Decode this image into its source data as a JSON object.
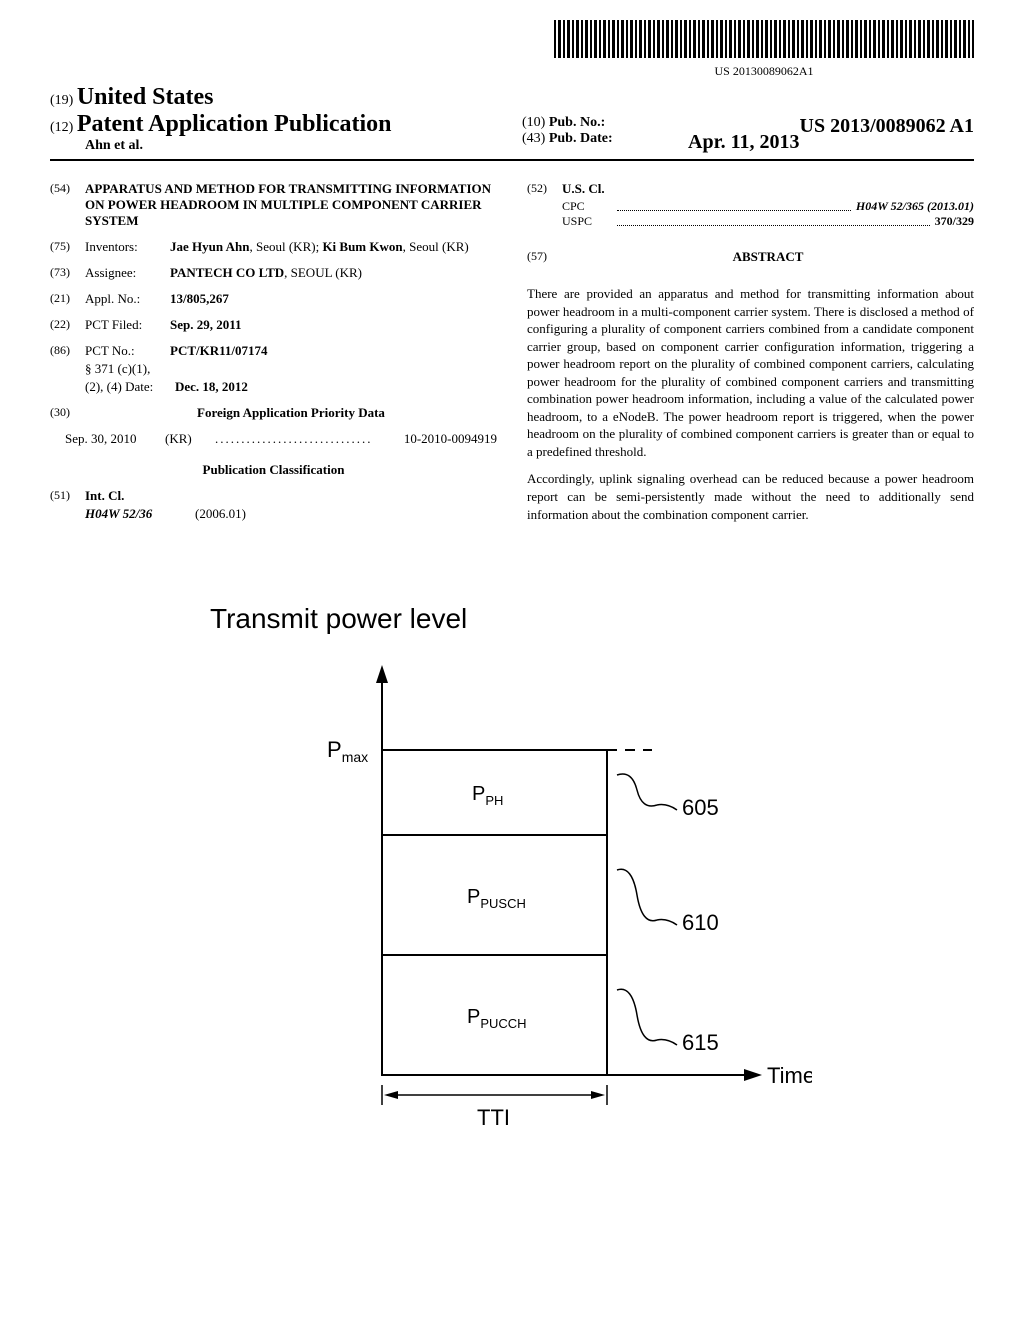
{
  "barcode": {
    "text": "US 20130089062A1"
  },
  "header": {
    "country_num": "(19)",
    "country": "United States",
    "pub_num": "(12)",
    "pub_title": "Patent Application Publication",
    "authors": "Ahn et al.",
    "pubno_num": "(10)",
    "pubno_label": "Pub. No.:",
    "pubno_value": "US 2013/0089062 A1",
    "pubdate_num": "(43)",
    "pubdate_label": "Pub. Date:",
    "pubdate_value": "Apr. 11, 2013"
  },
  "left": {
    "title_num": "(54)",
    "title": "APPARATUS AND METHOD FOR TRANSMITTING INFORMATION ON POWER HEADROOM IN MULTIPLE COMPONENT CARRIER SYSTEM",
    "inventors_num": "(75)",
    "inventors_label": "Inventors:",
    "inventors_value": "Jae Hyun Ahn, Seoul (KR); Ki Bum Kwon, Seoul (KR)",
    "assignee_num": "(73)",
    "assignee_label": "Assignee:",
    "assignee_value": "PANTECH CO LTD, SEOUL (KR)",
    "applno_num": "(21)",
    "applno_label": "Appl. No.:",
    "applno_value": "13/805,267",
    "pctfiled_num": "(22)",
    "pctfiled_label": "PCT Filed:",
    "pctfiled_value": "Sep. 29, 2011",
    "pctno_num": "(86)",
    "pctno_label": "PCT No.:",
    "pctno_value": "PCT/KR11/07174",
    "section371_label": "§ 371 (c)(1),",
    "section371_date_label": "(2), (4) Date:",
    "section371_date_value": "Dec. 18, 2012",
    "priority_num": "(30)",
    "priority_heading": "Foreign Application Priority Data",
    "priority_date": "Sep. 30, 2010",
    "priority_country": "(KR)",
    "priority_value": "10-2010-0094919",
    "pubclass_heading": "Publication Classification",
    "intcl_num": "(51)",
    "intcl_label": "Int. Cl.",
    "intcl_code": "H04W 52/36",
    "intcl_year": "(2006.01)"
  },
  "right": {
    "uscl_num": "(52)",
    "uscl_label": "U.S. Cl.",
    "cpc_label": "CPC",
    "cpc_value": "H04W 52/365 (2013.01)",
    "uspc_label": "USPC",
    "uspc_value": "370/329",
    "abstract_num": "(57)",
    "abstract_heading": "ABSTRACT",
    "abstract_p1": "There are provided an apparatus and method for transmitting information about power headroom in a multi-component carrier system. There is disclosed a method of configuring a plurality of component carriers combined from a candidate component carrier group, based on component carrier configuration information, triggering a power headroom report on the plurality of combined component carriers, calculating power headroom for the plurality of combined component carriers and transmitting combination power headroom information, including a value of the calculated power headroom, to a eNodeB. The power headroom report is triggered, when the power headroom on the plurality of combined component carriers is greater than or equal to a predefined threshold.",
    "abstract_p2": "Accordingly, uplink signaling overhead can be reduced because a power headroom report can be semi-persistently made without the need to additionally send information about the combination component carrier."
  },
  "figure": {
    "title": "Transmit power level",
    "y_label": "P",
    "y_label_sub": "max",
    "x_label": "Time",
    "tti_label": "TTI",
    "regions": [
      {
        "label": "P",
        "sub": "PH",
        "ref": "605"
      },
      {
        "label": "P",
        "sub": "PUSCH",
        "ref": "610"
      },
      {
        "label": "P",
        "sub": "PUCCH",
        "ref": "615"
      }
    ]
  },
  "chart_data": {
    "type": "diagram",
    "title": "Transmit power level",
    "xlabel": "Time",
    "ylabel": "Transmit power level",
    "y_marker": "P_max",
    "x_interval": "TTI",
    "stacked_regions": [
      {
        "name": "P_PUCCH",
        "reference": 615,
        "position": "bottom"
      },
      {
        "name": "P_PUSCH",
        "reference": 610,
        "position": "middle"
      },
      {
        "name": "P_PH",
        "reference": 605,
        "position": "top"
      }
    ],
    "note": "Conceptual stacked diagram showing headroom (P_PH) between P_max and PUSCH+PUCCH power within one TTI; no numeric axis values given."
  }
}
